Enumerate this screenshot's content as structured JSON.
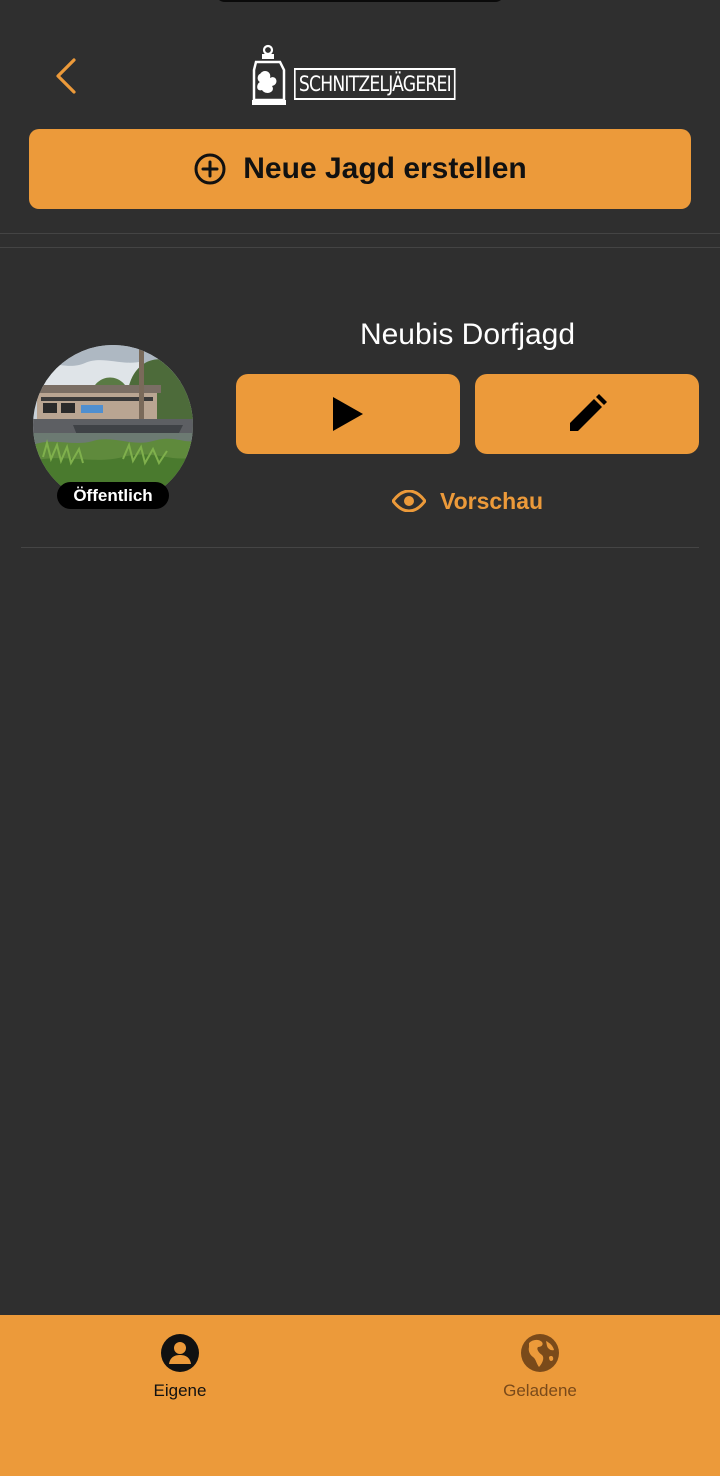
{
  "header": {
    "logo_text": "SCHNITZELJÄGEREI"
  },
  "actions": {
    "new_hunt_label": "Neue Jagd erstellen"
  },
  "hunts": [
    {
      "title": "Neubis Dorfjagd",
      "visibility": "Öffentlich",
      "preview_label": "Vorschau"
    }
  ],
  "tabs": [
    {
      "label": "Eigene",
      "icon": "person-icon",
      "active": true
    },
    {
      "label": "Geladene",
      "icon": "globe-icon",
      "active": false
    }
  ],
  "colors": {
    "background": "#2f2f2f",
    "accent": "#ec9a3a",
    "inactive_tab": "#7a4a1a"
  }
}
